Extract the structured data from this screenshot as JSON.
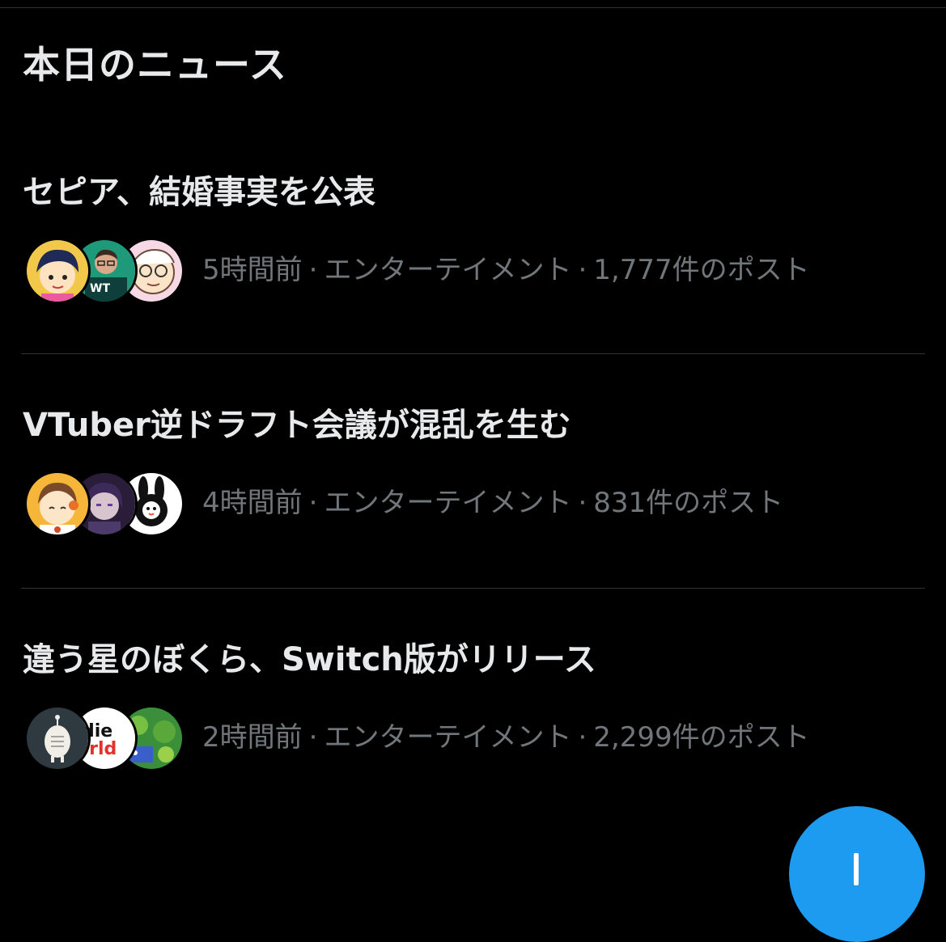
{
  "section": {
    "title": "本日のニュース"
  },
  "news": [
    {
      "headline": "セピア、結婚事実を公表",
      "time": "5時間前",
      "category": "エンターテイメント",
      "posts": "1,777件のポスト",
      "avatars": [
        "avatar-anime-boy-icon",
        "avatar-wt-man-icon",
        "avatar-glasses-face-icon"
      ]
    },
    {
      "headline": "VTuber逆ドラフト会議が混乱を生む",
      "time": "4時間前",
      "category": "エンターテイメント",
      "posts": "831件のポスト",
      "avatars": [
        "avatar-orange-character-icon",
        "avatar-purple-character-icon",
        "avatar-rabbit-icon"
      ]
    },
    {
      "headline": "違う星のぼくら、Switch版がリリース",
      "time": "2時間前",
      "category": "エンターテイメント",
      "posts": "2,299件のポスト",
      "avatars": [
        "avatar-robot-icon",
        "avatar-indie-world-logo-icon",
        "avatar-green-game-icon"
      ]
    }
  ],
  "separator": "·",
  "avatar_labels": {
    "wt": "WT",
    "indie_line1": "die",
    "indie_line2": "orld"
  },
  "colors": {
    "background": "#000000",
    "primary_text": "#e7e9ea",
    "secondary_text": "#71767b",
    "divider": "#2f3336",
    "accent": "#1d9bf0"
  },
  "fab": {
    "icon": "plus-icon"
  }
}
